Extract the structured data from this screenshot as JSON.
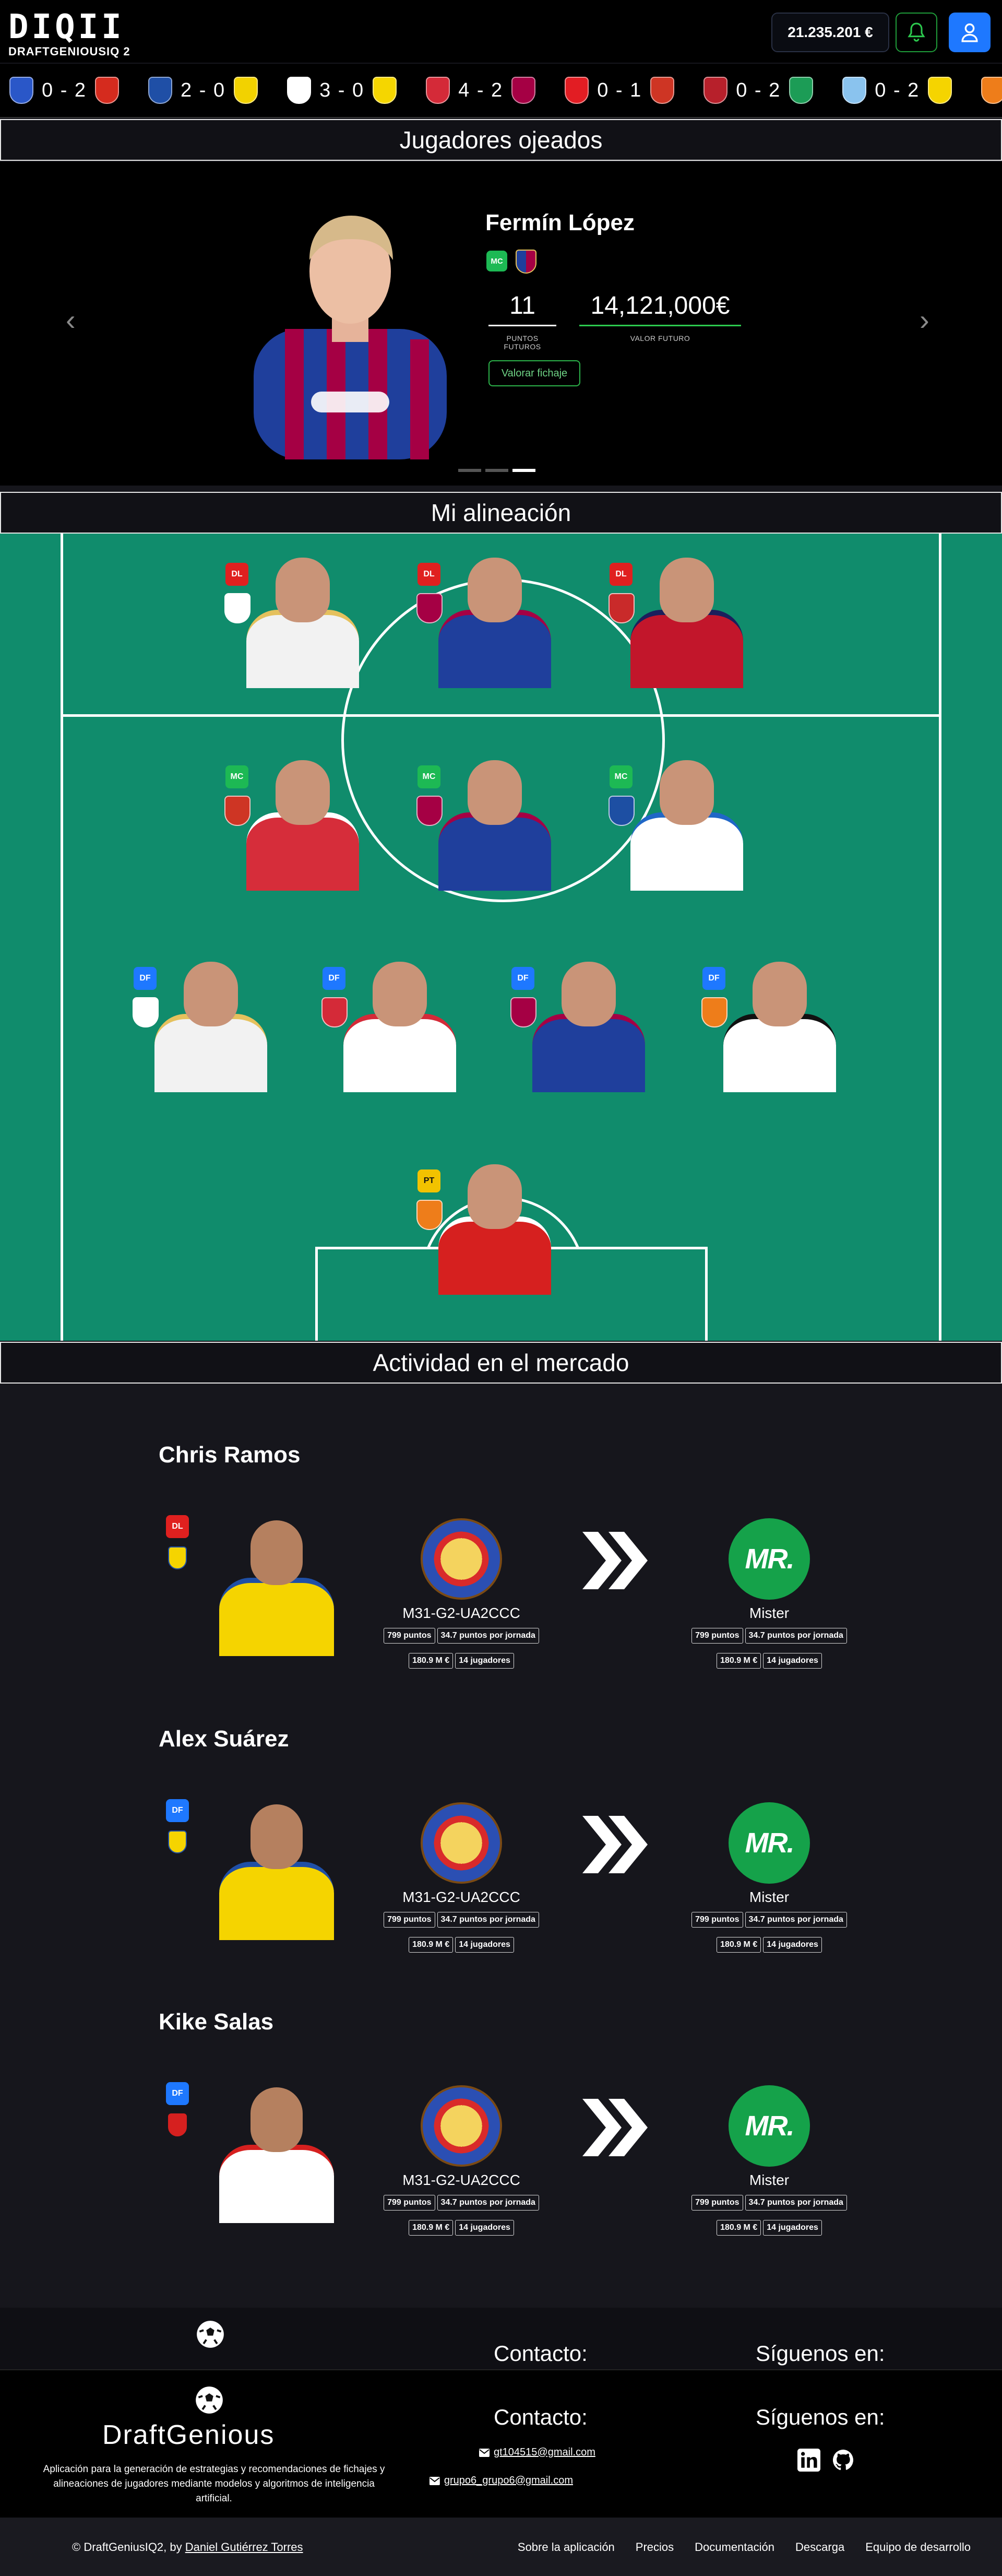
{
  "header": {
    "logo_mark": "DIQII",
    "logo_text": "DRAFTGENIOUSIQ 2",
    "budget": "21.235.201 €"
  },
  "matches": [
    {
      "score": "0 - 2",
      "home_color": "#2a57c8",
      "away_color": "#d52b1e"
    },
    {
      "score": "2 - 0",
      "home_color": "#1f4fa6",
      "away_color": "#f2d200"
    },
    {
      "score": "3 - 0",
      "home_color": "#ffffff",
      "away_color": "#f5d600"
    },
    {
      "score": "4 - 2",
      "home_color": "#d42a38",
      "away_color": "#a50044"
    },
    {
      "score": "0 - 1",
      "home_color": "#e21d23",
      "away_color": "#ce3524"
    },
    {
      "score": "0 - 2",
      "home_color": "#b7202b",
      "away_color": "#1c9c56"
    },
    {
      "score": "0 - 2",
      "home_color": "#8ac3ee",
      "away_color": "#f5d400"
    },
    {
      "score": "",
      "home_color": "#ee7d1a",
      "away_color": "#ee7d1a"
    }
  ],
  "sections": {
    "scouted": "Jugadores ojeados",
    "lineup": "Mi alineación",
    "market": "Actividad en el mercado"
  },
  "scouted_player": {
    "name": "Fermín López",
    "position": "MC",
    "future_points": "11",
    "future_points_label": "PUNTOS FUTUROS",
    "future_value": "14,121,000€",
    "future_value_label": "VALOR FUTURO",
    "button": "Valorar fichaje",
    "carousel_active": 3
  },
  "lineup": [
    {
      "pos": "DL",
      "badge_color": "#e0201f",
      "crest": "#ffffff",
      "kit": "#f2f2f2",
      "trim": "#e5c15d"
    },
    {
      "pos": "DL",
      "badge_color": "#e0201f",
      "crest": "#a50044",
      "kit": "#1f3f9c",
      "trim": "#a50044"
    },
    {
      "pos": "DL",
      "badge_color": "#e0201f",
      "crest": "#c92a2a",
      "kit": "#c2162b",
      "trim": "#1b1f5c"
    },
    {
      "pos": "MC",
      "badge_color": "#1db954",
      "crest": "#ce3524",
      "kit": "#d62d3a",
      "trim": "#ffffff"
    },
    {
      "pos": "MC",
      "badge_color": "#1db954",
      "crest": "#a50044",
      "kit": "#1f3f9c",
      "trim": "#a50044"
    },
    {
      "pos": "MC",
      "badge_color": "#1db954",
      "crest": "#1d4fa3",
      "kit": "#ffffff",
      "trim": "#2067c7"
    },
    {
      "pos": "DF",
      "badge_color": "#1e78ff",
      "crest": "#ffffff",
      "kit": "#f2f2f2",
      "trim": "#e5c15d"
    },
    {
      "pos": "DF",
      "badge_color": "#1e78ff",
      "crest": "#d42a38",
      "kit": "#ffffff",
      "trim": "#d42a38"
    },
    {
      "pos": "DF",
      "badge_color": "#1e78ff",
      "crest": "#a50044",
      "kit": "#1f3f9c",
      "trim": "#a50044"
    },
    {
      "pos": "DF",
      "badge_color": "#1e78ff",
      "crest": "#ee7d1a",
      "kit": "#ffffff",
      "trim": "#111111"
    },
    {
      "pos": "PT",
      "badge_color": "#f2c200",
      "crest": "#ee7d1a",
      "kit": "#d6201f",
      "trim": "#ffffff"
    }
  ],
  "market": [
    {
      "name": "Chris Ramos",
      "pos": "DL",
      "badge_color": "#e0201f",
      "crest": "#f5d400",
      "kit": "#f5d400",
      "trim": "#1f4fa6",
      "from_team": "M31-G2-UA2CCC",
      "to_team": "Mister",
      "from_stats": [
        "799 puntos",
        "34.7 puntos por jornada",
        "180.9 M €",
        "14 jugadores"
      ],
      "to_stats": [
        "799 puntos",
        "34.7 puntos por jornada",
        "180.9 M €",
        "14 jugadores"
      ]
    },
    {
      "name": "Alex Suárez",
      "pos": "DF",
      "badge_color": "#1e78ff",
      "crest": "#f5d400",
      "kit": "#f5d400",
      "trim": "#1f4fa6",
      "from_team": "M31-G2-UA2CCC",
      "to_team": "Mister",
      "from_stats": [
        "799 puntos",
        "34.7 puntos por jornada",
        "180.9 M €",
        "14 jugadores"
      ],
      "to_stats": [
        "799 puntos",
        "34.7 puntos por jornada",
        "180.9 M €",
        "14 jugadores"
      ]
    },
    {
      "name": "Kike Salas",
      "pos": "DF",
      "badge_color": "#1e78ff",
      "crest": "#d6201f",
      "kit": "#ffffff",
      "trim": "#d6201f",
      "from_team": "M31-G2-UA2CCC",
      "to_team": "Mister",
      "from_stats": [
        "799 puntos",
        "34.7 puntos por jornada",
        "180.9 M €",
        "14 jugadores"
      ],
      "to_stats": [
        "799 puntos",
        "34.7 puntos por jornada",
        "180.9 M €",
        "14 jugadores"
      ]
    }
  ],
  "mister_logo_text": "MR.",
  "footer": {
    "ghost_contact": "Contacto:",
    "ghost_follow": "Síguenos en:",
    "brand": "DraftGenious",
    "description": "Aplicación para la generación de estrategias y recomendaciones de fichajes y alineaciones de jugadores mediante modelos y algoritmos de inteligencia artificial.",
    "contact_title": "Contacto:",
    "emails": [
      "gt104515@gmail.com",
      "grupo6_grupo6@gmail.com"
    ],
    "follow_title": "Síguenos en:",
    "copyright_prefix": "© DraftGeniusIQ2, by ",
    "author": "Daniel Gutiérrez Torres",
    "links": [
      "Sobre la aplicación",
      "Precios",
      "Documentación",
      "Descarga",
      "Equipo de desarrollo"
    ]
  }
}
